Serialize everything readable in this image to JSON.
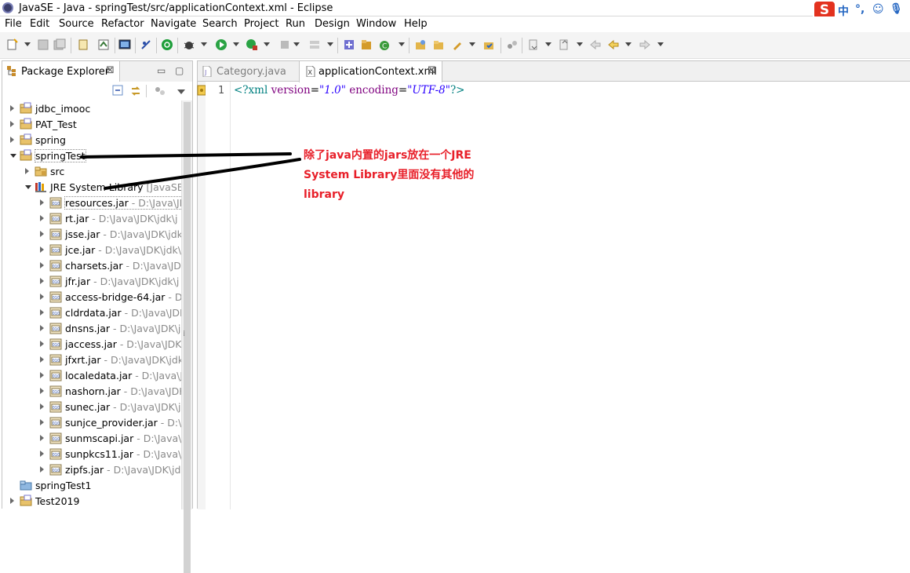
{
  "window": {
    "title": "JavaSE - Java - springTest/src/applicationContext.xml - Eclipse"
  },
  "ime": {
    "logo": "S",
    "chinese": "中",
    "punct": "°,",
    "smile": "☺",
    "mic": "🎙"
  },
  "menubar": {
    "items": [
      "File",
      "Edit",
      "Source",
      "Refactor",
      "Navigate",
      "Search",
      "Project",
      "Run",
      "Design",
      "Window",
      "Help"
    ]
  },
  "package_explorer": {
    "tab_label": "Package Explorer",
    "close": "⊠",
    "minimize": "▭",
    "maximize": "▢",
    "tree": [
      {
        "label": "jdbc_imooc",
        "path": "",
        "level": 0,
        "expand": "closed",
        "icon": "project-icon"
      },
      {
        "label": "PAT_Test",
        "path": "",
        "level": 0,
        "expand": "closed",
        "icon": "project-icon"
      },
      {
        "label": "spring",
        "path": "",
        "level": 0,
        "expand": "closed",
        "icon": "project-icon"
      },
      {
        "label": "springTest",
        "path": "",
        "level": 0,
        "expand": "open",
        "icon": "project-icon"
      },
      {
        "label": "src",
        "path": "",
        "level": 1,
        "expand": "closed",
        "icon": "source-folder-icon"
      },
      {
        "label": "JRE System Library",
        "path": "[JavaSE-",
        "level": 1,
        "expand": "open",
        "icon": "library-icon"
      },
      {
        "label": "resources.jar",
        "path": " - D:\\Java\\JDK",
        "level": 2,
        "expand": "closed",
        "icon": "jar-icon"
      },
      {
        "label": "rt.jar",
        "path": " - D:\\Java\\JDK\\jdk\\j",
        "level": 2,
        "expand": "closed",
        "icon": "jar-icon"
      },
      {
        "label": "jsse.jar",
        "path": " - D:\\Java\\JDK\\jdk",
        "level": 2,
        "expand": "closed",
        "icon": "jar-icon"
      },
      {
        "label": "jce.jar",
        "path": " - D:\\Java\\JDK\\jdk\\",
        "level": 2,
        "expand": "closed",
        "icon": "jar-icon"
      },
      {
        "label": "charsets.jar",
        "path": " - D:\\Java\\JDK",
        "level": 2,
        "expand": "closed",
        "icon": "jar-icon"
      },
      {
        "label": "jfr.jar",
        "path": " - D:\\Java\\JDK\\jdk\\j",
        "level": 2,
        "expand": "closed",
        "icon": "jar-icon"
      },
      {
        "label": "access-bridge-64.jar",
        "path": " - D",
        "level": 2,
        "expand": "closed",
        "icon": "jar-icon"
      },
      {
        "label": "cldrdata.jar",
        "path": " - D:\\Java\\JDK",
        "level": 2,
        "expand": "closed",
        "icon": "jar-icon"
      },
      {
        "label": "dnsns.jar",
        "path": " - D:\\Java\\JDK\\j",
        "level": 2,
        "expand": "closed",
        "icon": "jar-icon"
      },
      {
        "label": "jaccess.jar",
        "path": " - D:\\Java\\JDK\\",
        "level": 2,
        "expand": "closed",
        "icon": "jar-icon"
      },
      {
        "label": "jfxrt.jar",
        "path": " - D:\\Java\\JDK\\jdk",
        "level": 2,
        "expand": "closed",
        "icon": "jar-icon"
      },
      {
        "label": "localedata.jar",
        "path": " - D:\\Java\\J",
        "level": 2,
        "expand": "closed",
        "icon": "jar-icon"
      },
      {
        "label": "nashorn.jar",
        "path": " - D:\\Java\\JDK",
        "level": 2,
        "expand": "closed",
        "icon": "jar-icon"
      },
      {
        "label": "sunec.jar",
        "path": " - D:\\Java\\JDK\\j",
        "level": 2,
        "expand": "closed",
        "icon": "jar-icon"
      },
      {
        "label": "sunjce_provider.jar",
        "path": " - D:\\",
        "level": 2,
        "expand": "closed",
        "icon": "jar-icon"
      },
      {
        "label": "sunmscapi.jar",
        "path": " - D:\\Java\\",
        "level": 2,
        "expand": "closed",
        "icon": "jar-icon"
      },
      {
        "label": "sunpkcs11.jar",
        "path": " - D:\\Java\\J",
        "level": 2,
        "expand": "closed",
        "icon": "jar-icon"
      },
      {
        "label": "zipfs.jar",
        "path": " - D:\\Java\\JDK\\jdk",
        "level": 2,
        "expand": "closed",
        "icon": "jar-icon"
      },
      {
        "label": "springTest1",
        "path": "",
        "level": 0,
        "expand": "none",
        "icon": "folder-icon"
      },
      {
        "label": "Test2019",
        "path": "",
        "level": 0,
        "expand": "closed",
        "icon": "project-icon"
      }
    ]
  },
  "editor": {
    "tabs": [
      {
        "label": "Category.java",
        "active": false,
        "icon": "java-file-icon"
      },
      {
        "label": "applicationContext.xml",
        "active": true,
        "icon": "xml-file-icon",
        "close": "⊠"
      }
    ],
    "line_number": "1",
    "code": {
      "pi_open": "<?xml",
      "attr1": "version",
      "eq": "=",
      "val1": "\"1.0\"",
      "attr2": "encoding",
      "val2": "\"UTF-8\"",
      "pi_close": "?>"
    }
  },
  "annotation": {
    "text": "除了java内置的jars放在一个JRE System Library里面没有其他的library",
    "color": "#e8202a"
  }
}
